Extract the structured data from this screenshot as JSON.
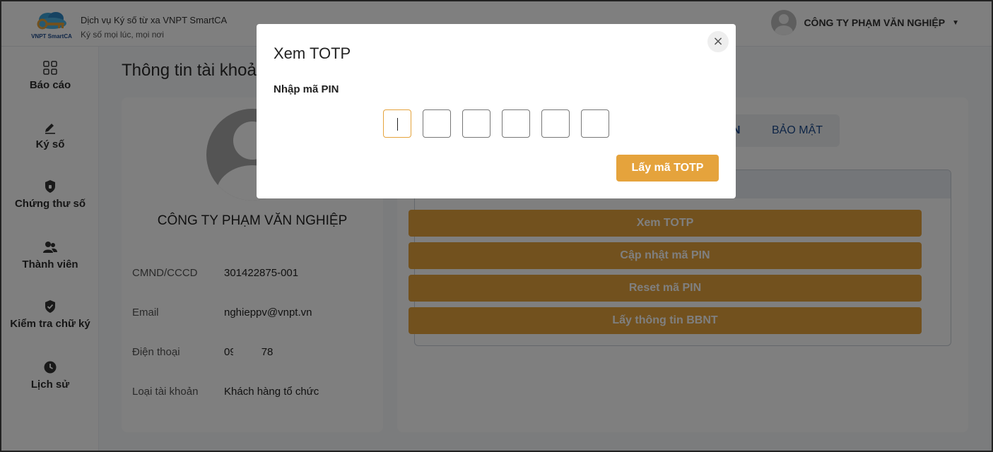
{
  "header": {
    "logo_text": "VNPT SmartCA",
    "brand_title": "Dịch vụ Ký số từ xa VNPT SmartCA",
    "brand_subtitle": "Ký số mọi lúc, mọi nơi",
    "user_name": "CÔNG TY PHẠM VĂN NGHIỆP"
  },
  "sidebar": {
    "items": [
      {
        "label": "Báo cáo",
        "icon": "grid-icon"
      },
      {
        "label": "Ký số",
        "icon": "pen-icon"
      },
      {
        "label": "Chứng thư số",
        "icon": "shield-lock-icon"
      },
      {
        "label": "Thành viên",
        "icon": "users-icon"
      },
      {
        "label": "Kiểm tra chữ ký",
        "icon": "shield-check-icon"
      },
      {
        "label": "Lịch sử",
        "icon": "clock-icon"
      }
    ]
  },
  "main": {
    "page_title": "Thông tin tài khoả",
    "profile": {
      "company": "CÔNG TY PHẠM VĂN NGHIỆP",
      "fields": [
        {
          "label": "CMND/CCCD",
          "value": "301422875-001"
        },
        {
          "label": "Email",
          "value": "nghieppv@vnpt.vn"
        },
        {
          "label": "Điện thoại",
          "value_start": "09",
          "value_end": "78"
        },
        {
          "label": "Loại tài khoản",
          "value": "Khách hàng tổ chức"
        }
      ]
    },
    "tabs": {
      "partial": "N",
      "security": "BẢO MẬT"
    },
    "actions": [
      "Xem TOTP",
      "Cập nhật mã PIN",
      "Reset mã PIN",
      "Lấy thông tin BBNT"
    ]
  },
  "modal": {
    "title": "Xem TOTP",
    "close_symbol": "×",
    "pin_label": "Nhập mã PIN",
    "pin_length": 6,
    "submit_label": "Lấy mã TOTP"
  },
  "colors": {
    "accent": "#E5A33C",
    "tab_text": "#1C4A8C",
    "overlay": "rgba(0,0,0,0.5)"
  }
}
